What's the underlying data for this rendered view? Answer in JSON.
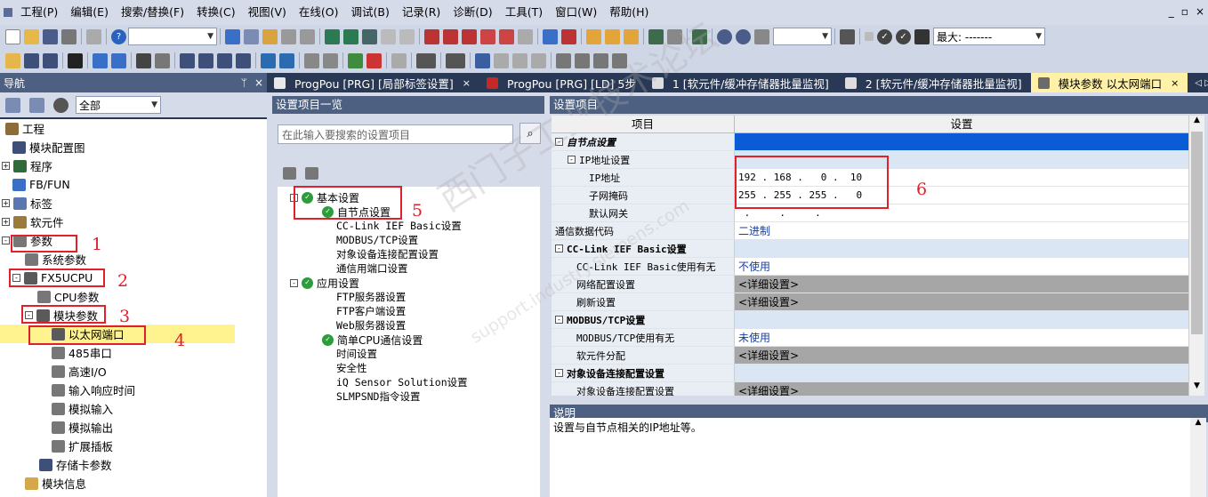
{
  "menu": [
    "工程(P)",
    "编辑(E)",
    "搜索/替换(F)",
    "转换(C)",
    "视图(V)",
    "在线(O)",
    "调试(B)",
    "记录(R)",
    "诊断(D)",
    "工具(T)",
    "窗口(W)",
    "帮助(H)"
  ],
  "window_controls": [
    "_",
    "▫",
    "×"
  ],
  "toolbar": {
    "max_label": "最大: -------"
  },
  "nav": {
    "title": "导航",
    "pin": "ᛘ",
    "close": "×",
    "filter_value": "全部",
    "tree": [
      {
        "label": "工程"
      },
      {
        "label": "模块配置图"
      },
      {
        "label": "程序"
      },
      {
        "label": "FB/FUN"
      },
      {
        "label": "标签"
      },
      {
        "label": "软元件"
      },
      {
        "label": "参数"
      },
      {
        "label": "系统参数"
      },
      {
        "label": "FX5UCPU"
      },
      {
        "label": "CPU参数"
      },
      {
        "label": "模块参数"
      },
      {
        "label": "以太网端口"
      },
      {
        "label": "485串口"
      },
      {
        "label": "高速I/O"
      },
      {
        "label": "输入响应时间"
      },
      {
        "label": "模拟输入"
      },
      {
        "label": "模拟输出"
      },
      {
        "label": "扩展插板"
      },
      {
        "label": "存储卡参数"
      },
      {
        "label": "模块信息"
      }
    ]
  },
  "annotations": [
    "1",
    "2",
    "3",
    "4",
    "5",
    "6"
  ],
  "tabs": [
    {
      "label": "ProgPou [PRG] [局部标签设置]"
    },
    {
      "label": "ProgPou [PRG] [LD] 5步"
    },
    {
      "label": "1 [软元件/缓冲存储器批量监视]"
    },
    {
      "label": "2 [软元件/缓冲存储器批量监视]"
    },
    {
      "label": "模块参数 以太网端口"
    }
  ],
  "tab_arrows": "◁ ▷ ▾",
  "left_pane": {
    "title": "设置项目一览",
    "search_placeholder": "在此输入要搜索的设置项目",
    "items": [
      {
        "label": "基本设置"
      },
      {
        "label": "自节点设置"
      },
      {
        "label": "CC-Link IEF Basic设置"
      },
      {
        "label": "MODBUS/TCP设置"
      },
      {
        "label": "对象设备连接配置设置"
      },
      {
        "label": "通信用端口设置"
      },
      {
        "label": "应用设置"
      },
      {
        "label": "FTP服务器设置"
      },
      {
        "label": "FTP客户端设置"
      },
      {
        "label": "Web服务器设置"
      },
      {
        "label": "简单CPU通信设置"
      },
      {
        "label": "时间设置"
      },
      {
        "label": "安全性"
      },
      {
        "label": "iQ Sensor Solution设置"
      },
      {
        "label": "SLMPSND指令设置"
      }
    ]
  },
  "right_pane": {
    "title": "设置项目",
    "col_item": "项目",
    "col_setting": "设置",
    "rows": [
      {
        "item": "自节点设置",
        "value": ""
      },
      {
        "item": "IP地址设置",
        "value": ""
      },
      {
        "item": "IP地址",
        "value": "192 . 168 .   0 .  10"
      },
      {
        "item": "子网掩码",
        "value": "255 . 255 . 255 .   0"
      },
      {
        "item": "默认网关",
        "value": " .     .     ."
      },
      {
        "item": "通信数据代码",
        "value": "二进制"
      },
      {
        "item": "CC-Link IEF Basic设置",
        "value": ""
      },
      {
        "item": "CC-Link IEF Basic使用有无",
        "value": "不使用"
      },
      {
        "item": "网络配置设置",
        "value": "<详细设置>"
      },
      {
        "item": "刷新设置",
        "value": "<详细设置>"
      },
      {
        "item": "MODBUS/TCP设置",
        "value": ""
      },
      {
        "item": "MODBUS/TCP使用有无",
        "value": "未使用"
      },
      {
        "item": "软元件分配",
        "value": "<详细设置>"
      },
      {
        "item": "对象设备连接配置设置",
        "value": ""
      },
      {
        "item": "对象设备连接配置设置",
        "value": "<详细设置>"
      }
    ]
  },
  "description": {
    "title": "说明",
    "text": "设置与自节点相关的IP地址等。"
  },
  "watermark": {
    "text": "西门子工业技术论坛",
    "sub": "support.industry.siemens.com"
  },
  "colors": {
    "nav_bg": "#293955",
    "header_blue": "#4d6082",
    "selected": "#fef38f",
    "annotation_red": "#e0202a",
    "group_blue": "#0b5ad6"
  }
}
